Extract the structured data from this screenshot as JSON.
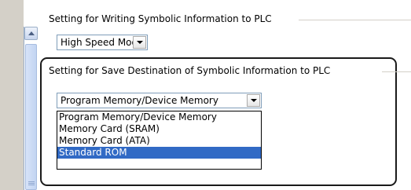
{
  "writing_group": {
    "title": "Setting for Writing Symbolic Information to PLC",
    "mode_value": "High Speed Mode"
  },
  "save_group": {
    "title": "Setting for Save Destination of Symbolic Information to PLC",
    "selected_value": "Program Memory/Device Memory",
    "options": [
      "Program Memory/Device Memory",
      "Memory Card (SRAM)",
      "Memory Card (ATA)",
      "Standard ROM"
    ],
    "highlighted_option": "Standard ROM"
  },
  "icons": {
    "scroll_up": "scroll-up-arrow-icon",
    "dropdown": "dropdown-arrow-icon"
  },
  "colors": {
    "selection_bg": "#316ac5",
    "field_border": "#7f9db9",
    "highlight_frame": "#1a1a1a"
  }
}
